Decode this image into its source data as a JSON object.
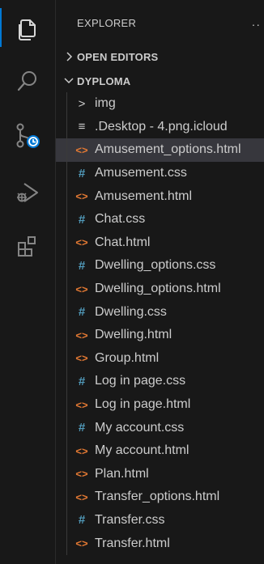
{
  "explorer": {
    "title": "EXPLORER",
    "more": "··"
  },
  "sections": {
    "open_editors": "OPEN EDITORS",
    "project": "DYPLOMA"
  },
  "icons": {
    "files": "files-icon",
    "search": "search-icon",
    "source_control": "source-control-icon",
    "run_debug": "run-debug-icon",
    "extensions": "extensions-icon",
    "chevron_right": "chevron-right-icon",
    "chevron_down": "chevron-down-icon"
  },
  "colors": {
    "html_icon": "#e37933",
    "css_icon": "#519aba",
    "accent": "#0078d4",
    "selection": "#37373d"
  },
  "tree": [
    {
      "label": "img",
      "kind": "folder",
      "glyph": ">"
    },
    {
      "label": ".Desktop - 4.png.icloud",
      "kind": "file",
      "glyph": "≡"
    },
    {
      "label": "Amusement_options.html",
      "kind": "html",
      "glyph": "<>",
      "selected": true
    },
    {
      "label": "Amusement.css",
      "kind": "css",
      "glyph": "#"
    },
    {
      "label": "Amusement.html",
      "kind": "html",
      "glyph": "<>"
    },
    {
      "label": "Chat.css",
      "kind": "css",
      "glyph": "#"
    },
    {
      "label": "Chat.html",
      "kind": "html",
      "glyph": "<>"
    },
    {
      "label": "Dwelling_options.css",
      "kind": "css",
      "glyph": "#"
    },
    {
      "label": "Dwelling_options.html",
      "kind": "html",
      "glyph": "<>"
    },
    {
      "label": "Dwelling.css",
      "kind": "css",
      "glyph": "#"
    },
    {
      "label": "Dwelling.html",
      "kind": "html",
      "glyph": "<>"
    },
    {
      "label": "Group.html",
      "kind": "html",
      "glyph": "<>"
    },
    {
      "label": "Log in page.css",
      "kind": "css",
      "glyph": "#"
    },
    {
      "label": "Log in page.html",
      "kind": "html",
      "glyph": "<>"
    },
    {
      "label": "My account.css",
      "kind": "css",
      "glyph": "#"
    },
    {
      "label": "My account.html",
      "kind": "html",
      "glyph": "<>"
    },
    {
      "label": "Plan.html",
      "kind": "html",
      "glyph": "<>"
    },
    {
      "label": "Transfer_options.html",
      "kind": "html",
      "glyph": "<>"
    },
    {
      "label": "Transfer.css",
      "kind": "css",
      "glyph": "#"
    },
    {
      "label": "Transfer.html",
      "kind": "html",
      "glyph": "<>"
    }
  ]
}
